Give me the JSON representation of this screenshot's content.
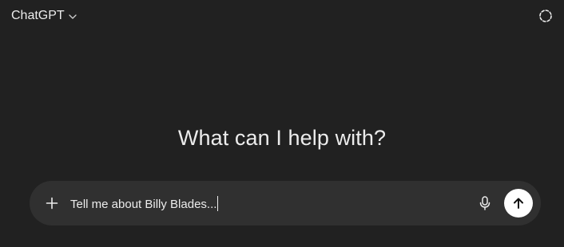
{
  "header": {
    "model_name": "ChatGPT",
    "model_switcher_icon": "chevron-down-icon",
    "temporary_chat_icon": "dashed-circle-icon"
  },
  "main": {
    "headline": "What can I help with?"
  },
  "composer": {
    "input_value": "Tell me about Billy Blades...",
    "add_icon": "plus-icon",
    "mic_icon": "microphone-icon",
    "send_icon": "arrow-up-icon"
  },
  "colors": {
    "background": "#212121",
    "composer_background": "#303030",
    "text": "#ececec",
    "send_button": "#ffffff"
  }
}
